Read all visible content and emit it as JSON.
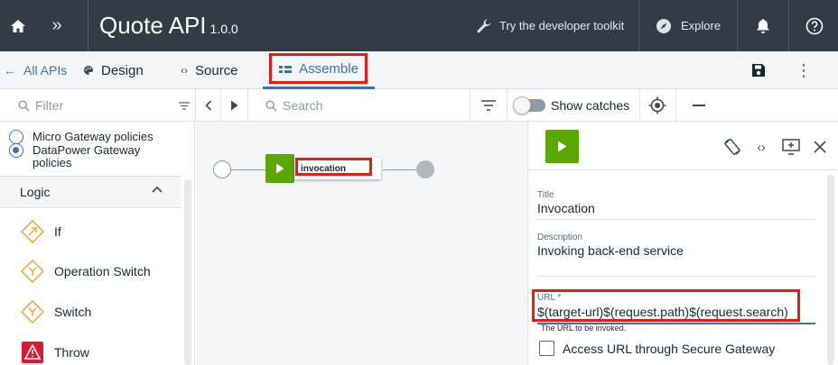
{
  "topbar": {
    "title": "Quote API",
    "version": "1.0.0",
    "toolkit_label": "Try the developer toolkit",
    "explore_label": "Explore"
  },
  "navbar": {
    "back_label": "All APIs",
    "tabs": [
      {
        "label": "Design",
        "icon": "palette-icon"
      },
      {
        "label": "Source",
        "icon": "code-icon"
      },
      {
        "label": "Assemble",
        "icon": "assemble-icon",
        "active": true
      }
    ]
  },
  "toolbar": {
    "filter_placeholder": "Filter",
    "search_placeholder": "Search",
    "show_catches_label": "Show catches",
    "show_catches_on": false
  },
  "palette": {
    "policy_types": [
      {
        "label": "Micro Gateway policies",
        "selected": false
      },
      {
        "label": "DataPower Gateway policies",
        "selected": true
      }
    ],
    "section_title": "Logic",
    "items": [
      {
        "label": "If",
        "icon": "if-icon"
      },
      {
        "label": "Operation Switch",
        "icon": "operation-switch-icon"
      },
      {
        "label": "Switch",
        "icon": "switch-icon"
      },
      {
        "label": "Throw",
        "icon": "throw-icon"
      }
    ]
  },
  "canvas": {
    "node_label": "invocation"
  },
  "properties": {
    "title_label": "Title",
    "title_value": "Invocation",
    "description_label": "Description",
    "description_value": "Invoking back-end service",
    "url_label": "URL *",
    "url_value": "$(target-url)$(request.path)$(request.search)",
    "url_help": "The URL to be invoked.",
    "secure_gateway_label": "Access URL through Secure Gateway",
    "secure_gateway_checked": false
  },
  "colors": {
    "topbar_bg": "#323c46",
    "accent": "#3d70b2",
    "node_green": "#5aa700",
    "highlight_red": "#ea1c0d"
  }
}
